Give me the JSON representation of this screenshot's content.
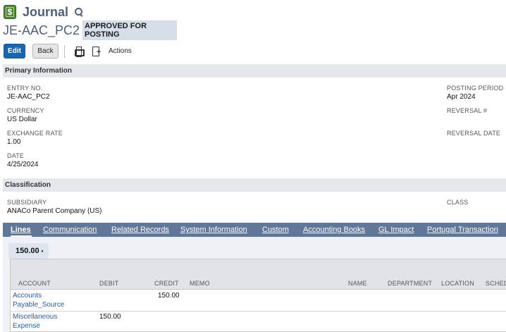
{
  "header": {
    "title": "Journal",
    "record_id": "JE-AAC_PC2",
    "status": "APPROVED FOR POSTING",
    "icon": "journal-dollar-icon"
  },
  "toolbar": {
    "edit_label": "Edit",
    "back_label": "Back",
    "actions_label": "Actions"
  },
  "primary": {
    "title": "Primary Information",
    "entry_no": {
      "label": "ENTRY NO.",
      "value": "JE-AAC_PC2"
    },
    "currency": {
      "label": "CURRENCY",
      "value": "US Dollar"
    },
    "exchange_rate": {
      "label": "EXCHANGE RATE",
      "value": "1.00"
    },
    "date": {
      "label": "DATE",
      "value": "4/25/2024"
    },
    "posting_period": {
      "label": "POSTING PERIOD",
      "value": "Apr 2024"
    },
    "reversal_no": {
      "label": "REVERSAL #",
      "value": ""
    },
    "reversal_date": {
      "label": "REVERSAL DATE",
      "value": ""
    }
  },
  "classification": {
    "title": "Classification",
    "subsidiary": {
      "label": "SUBSIDIARY",
      "value": "ANACo Parent Company (US)"
    },
    "class": {
      "label": "CLASS",
      "value": ""
    }
  },
  "tabs": [
    {
      "label": "Lines",
      "active": true
    },
    {
      "label": "Communication"
    },
    {
      "label": "Related Records"
    },
    {
      "label": "System Information"
    },
    {
      "label": "Custom"
    },
    {
      "label": "Accounting Books"
    },
    {
      "label": "GL Impact"
    },
    {
      "label": "Portugal Transaction"
    }
  ],
  "lines": {
    "total": "150.00",
    "total_marker": "•",
    "columns": [
      "ACCOUNT",
      "DEBIT",
      "CREDIT",
      "MEMO",
      "NAME",
      "DEPARTMENT",
      "LOCATION",
      "SCHEDU"
    ],
    "rows": [
      {
        "account": "Accounts Payable_Source",
        "debit": "",
        "credit": "150.00",
        "memo": ""
      },
      {
        "account": "Miscellaneous Expense",
        "debit": "150.00",
        "credit": "",
        "memo": ""
      }
    ]
  }
}
